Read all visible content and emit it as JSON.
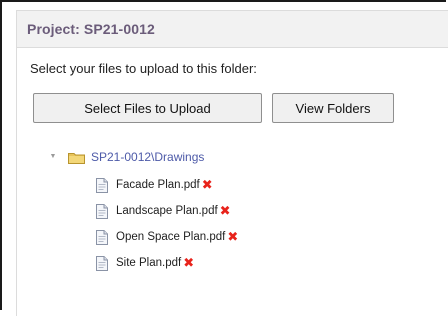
{
  "project": {
    "title": "Project: SP21-0012"
  },
  "upload": {
    "instruction": "Select your files to upload to this folder:",
    "select_button_label": "Select Files to Upload",
    "view_folders_button_label": "View Folders"
  },
  "tree": {
    "expander_glyph": "▼",
    "folder": {
      "label": "SP21-0012\\Drawings",
      "icon": "folder-icon"
    },
    "files": [
      {
        "label": "Facade Plan.pdf",
        "icon": "file-icon",
        "delete_glyph": "✖"
      },
      {
        "label": "Landscape Plan.pdf",
        "icon": "file-icon",
        "delete_glyph": "✖"
      },
      {
        "label": "Open Space Plan.pdf",
        "icon": "file-icon",
        "delete_glyph": "✖"
      },
      {
        "label": "Site Plan.pdf",
        "icon": "file-icon",
        "delete_glyph": "✖"
      }
    ]
  },
  "colors": {
    "title": "#6b5c7a",
    "folder_label": "#4d5aa8",
    "delete": "#e8231b",
    "folder": "#e7c35a"
  }
}
